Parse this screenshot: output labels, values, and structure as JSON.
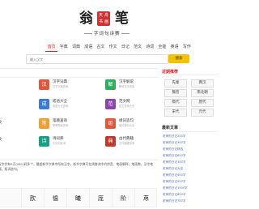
{
  "logo": {
    "chars": [
      "翁",
      "笔"
    ],
    "seal_chars": [
      "天",
      "舟",
      "书",
      "画"
    ],
    "subtitle": "字词句诗赛"
  },
  "nav": {
    "items": [
      "首页",
      "字典",
      "词典",
      "成语",
      "古文",
      "作文",
      "日记",
      "范文",
      "诗词",
      "全能",
      "英语",
      "写作"
    ],
    "active_index": 0
  },
  "search": {
    "placeholder": "输入汉字",
    "button_label": "搜索"
  },
  "main": {
    "left_edge_labels": [
      "文",
      "文"
    ],
    "grid": [
      {
        "title": "汉字词典",
        "desc": "汉字字典查询",
        "color": "#e0573b",
        "glyph": "汉"
      },
      {
        "title": "成语大全",
        "desc": "成语大全查询",
        "color": "#3a7bd5",
        "glyph": "成"
      },
      {
        "title": "汉字解说",
        "desc": "解说汉字查询",
        "color": "#2fae63",
        "glyph": "解"
      },
      {
        "title": "范文网",
        "desc": "范文查询大全",
        "color": "#f0a030",
        "glyph": "范"
      },
      {
        "title": "笔顺查询",
        "desc": "笔顺笔画查询",
        "color": "#8e44ad",
        "glyph": "笔"
      },
      {
        "title": "组词造句",
        "desc": "组词造句大全",
        "color": "#e0573b",
        "glyph": "组"
      },
      {
        "title": "诗词库",
        "desc": "古诗词查询",
        "color": "#16a085",
        "glyph": "诗"
      },
      {
        "title": "古代典籍",
        "desc": "古代典籍查询",
        "color": "#c0392b",
        "glyph": "典"
      }
    ],
    "intro": "汉字共有5万(281)码多个，最超新华字典中所有汉字，新华字典可在线查询字的拼音、笔画解释，笔画数，汉字笔顺，组词造句。",
    "chars": [
      "",
      "肷",
      "愠",
      "曦",
      "厐",
      "阶",
      "荩"
    ]
  },
  "sidebar": {
    "recommend_title": "近期推荐",
    "tags": [
      "先秦",
      "两汉",
      "魏晋",
      "南北朝",
      "隋代",
      "唐代",
      "宋代",
      "元代"
    ],
    "article_title": "最新文章",
    "articles": [
      "老师的日记200字",
      "老师的日记300字",
      "老师的日记精选",
      "老师的日记600字",
      "老师的日记100字",
      "老师的日记大全",
      "老师的日记400字",
      "老师的日记500字",
      "老师的日记1000字",
      "老师的日记800字",
      "老师的日记700字"
    ]
  },
  "colors": {
    "accent": "#d22222",
    "search_button": "#f5c200",
    "link": "#4a6fa5"
  }
}
